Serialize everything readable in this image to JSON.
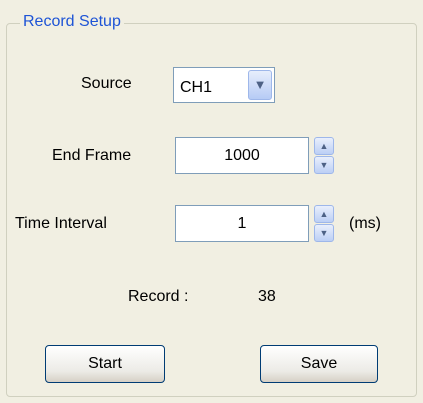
{
  "group": {
    "title": "Record Setup"
  },
  "source": {
    "label": "Source",
    "value": "CH1",
    "dropdown_icon": "chevron-down-icon"
  },
  "end_frame": {
    "label": "End Frame",
    "value": "1000"
  },
  "time_interval": {
    "label": "Time Interval",
    "value": "1",
    "unit": "(ms)"
  },
  "record": {
    "label": "Record :",
    "value": "38"
  },
  "buttons": {
    "start": "Start",
    "save": "Save"
  },
  "colors": {
    "accent": "#1e54d6",
    "background": "#f1efe2",
    "field_border": "#7f9db9"
  }
}
